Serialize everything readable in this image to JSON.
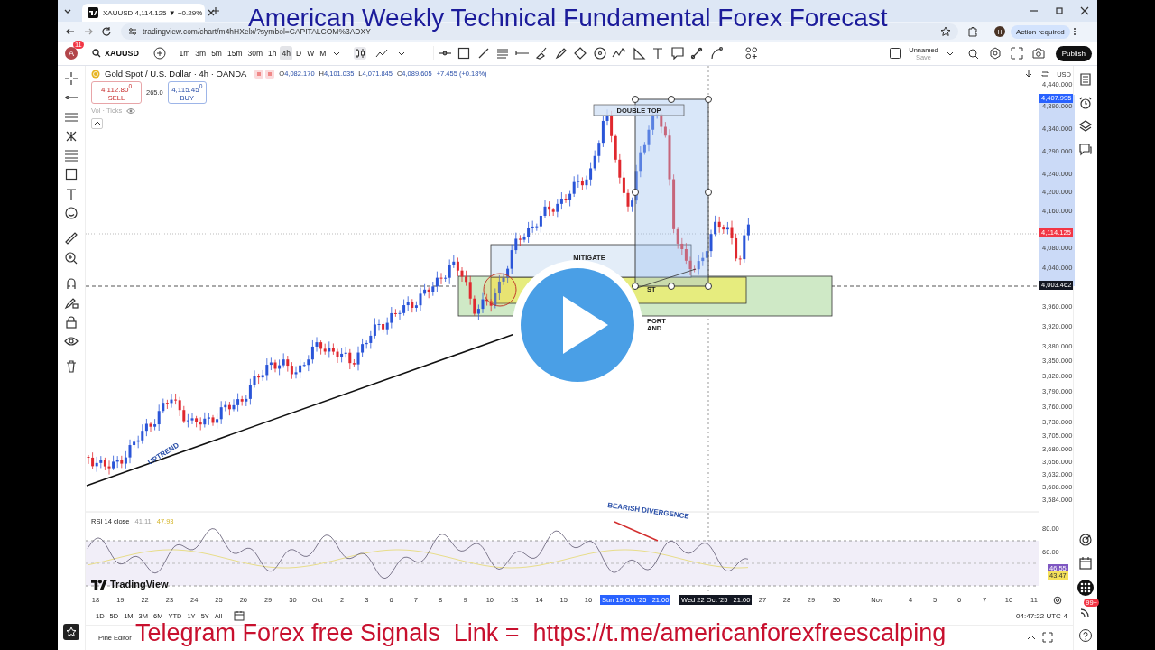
{
  "overlay_title": "American Weekly Technical Fundamental Forex Forecast",
  "overlay_footer": "Telegram Forex free Signals  Link =  https://t.me/americanforexfreescalping",
  "browser": {
    "tab_title": "XAUUSD 4,114.125 ▼ −0.29%",
    "url": "tradingview.com/chart/m4hHXelx/?symbol=CAPITALCOM%3ADXY",
    "profile": "H",
    "action": "Action required"
  },
  "toolbar": {
    "avatar": "A",
    "avatar_badge": "11",
    "symbol": "XAUUSD",
    "intervals": [
      {
        "label": "1m",
        "selected": false
      },
      {
        "label": "3m",
        "selected": false
      },
      {
        "label": "5m",
        "selected": false
      },
      {
        "label": "15m",
        "selected": false
      },
      {
        "label": "30m",
        "selected": false
      },
      {
        "label": "1h",
        "selected": false
      },
      {
        "label": "4h",
        "selected": true
      },
      {
        "label": "D",
        "selected": false
      },
      {
        "label": "W",
        "selected": false
      },
      {
        "label": "M",
        "selected": false
      }
    ],
    "layout_name": "Unnamed",
    "layout_sub": "Save",
    "publish": "Publish"
  },
  "legend": {
    "title": "Gold Spot / U.S. Dollar · 4h · OANDA",
    "ohlc": [
      {
        "key": "O",
        "value": "4,082.170"
      },
      {
        "key": "H",
        "value": "4,101.035"
      },
      {
        "key": "L",
        "value": "4,071.845"
      },
      {
        "key": "C",
        "value": "4,089.605"
      }
    ],
    "change": "+7.455 (+0.18%)",
    "sell_price": "4,112.80$^{0}$",
    "sell": "SELL",
    "spread": "265.0",
    "buy_price": "4,115.45$^{0}$",
    "buy": "BUY",
    "volume": "Vol · Ticks"
  },
  "currency": "USD",
  "price_axis": [
    "4,440.000",
    "4,390.000",
    "4,340.000",
    "4,290.000",
    "4,240.000",
    "4,200.000",
    "4,160.000",
    "4,080.000",
    "4,040.000",
    "3,960.000",
    "3,920.000",
    "3,880.000",
    "3,850.000",
    "3,820.000",
    "3,790.000",
    "3,760.000",
    "3,730.000",
    "3,705.000",
    "3,680.000",
    "3,656.000",
    "3,632.000",
    "3,608.000",
    "3,584.000"
  ],
  "price_badges": [
    {
      "text": "4,407.995",
      "color": "#2962ff"
    },
    {
      "text": "4,114.125",
      "color": "#f23645"
    },
    {
      "text": "4,003.462",
      "color": "#131722"
    }
  ],
  "drawings": {
    "double_top": "DOUBLE TOP",
    "mitigate": "MITIGATE",
    "test": "ST",
    "support": "PORT",
    "demand": "AND",
    "uptrend": "UPTREND",
    "divergence": "BEARISH DIVERGENCE"
  },
  "rsi": {
    "title": "RSI 14 close",
    "value": "41.11",
    "ma": "47.93",
    "axis": [
      "80.00",
      "60.00"
    ],
    "badges": [
      {
        "text": "46.55",
        "color": "#7e57c2"
      },
      {
        "text": "43.47",
        "color": "#f5e15a"
      }
    ]
  },
  "time_axis": [
    "18",
    "19",
    "22",
    "23",
    "24",
    "25",
    "26",
    "29",
    "30",
    "Oct",
    "2",
    "3",
    "6",
    "7",
    "8",
    "9",
    "10",
    "13",
    "14",
    "15",
    "16",
    "27",
    "28",
    "29",
    "30",
    "Nov",
    "4",
    "5",
    "6",
    "7",
    "10",
    "11"
  ],
  "time_badges": [
    {
      "text": "Sun 19 Oct '25   21:00",
      "color": "#2962ff"
    },
    {
      "text": "Wed 22 Oct '25   21:00",
      "color": "#131722"
    }
  ],
  "brand": "TradingView",
  "ranges": [
    "1D",
    "5D",
    "1M",
    "3M",
    "6M",
    "YTD",
    "1Y",
    "5Y",
    "All"
  ],
  "clock": "04:47:22 UTC-4",
  "bottom_tabs": [
    "Pine Editor"
  ],
  "notifications": "99+"
}
